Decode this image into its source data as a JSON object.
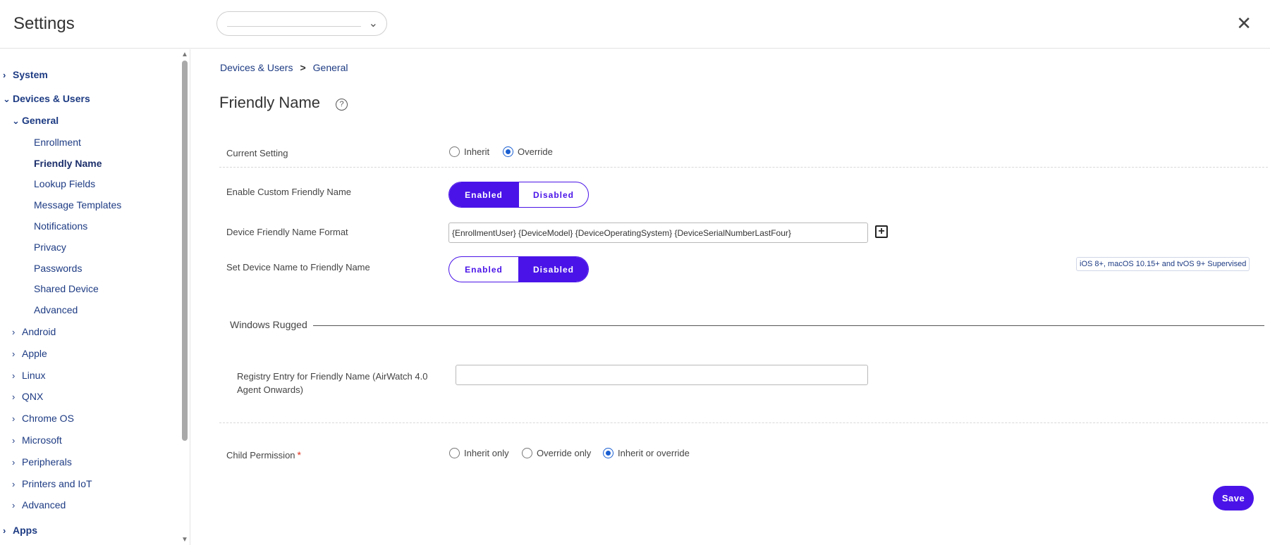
{
  "header": {
    "title": "Settings",
    "org_select_value": "",
    "close_icon": "close-icon"
  },
  "sidebar": {
    "items": [
      {
        "label": "System",
        "level": 1,
        "expanded": false
      },
      {
        "label": "Devices & Users",
        "level": 1,
        "expanded": true
      },
      {
        "label": "General",
        "level": 2,
        "expanded": true
      },
      {
        "label": "Enrollment",
        "level": 3
      },
      {
        "label": "Friendly Name",
        "level": 3,
        "active": true
      },
      {
        "label": "Lookup Fields",
        "level": 3
      },
      {
        "label": "Message Templates",
        "level": 3
      },
      {
        "label": "Notifications",
        "level": 3
      },
      {
        "label": "Privacy",
        "level": 3
      },
      {
        "label": "Passwords",
        "level": 3
      },
      {
        "label": "Shared Device",
        "level": 3
      },
      {
        "label": "Advanced",
        "level": 3
      },
      {
        "label": "Android",
        "level": 2,
        "expanded": false
      },
      {
        "label": "Apple",
        "level": 2,
        "expanded": false
      },
      {
        "label": "Linux",
        "level": 2,
        "expanded": false
      },
      {
        "label": "QNX",
        "level": 2,
        "expanded": false
      },
      {
        "label": "Chrome OS",
        "level": 2,
        "expanded": false
      },
      {
        "label": "Microsoft",
        "level": 2,
        "expanded": false
      },
      {
        "label": "Peripherals",
        "level": 2,
        "expanded": false
      },
      {
        "label": "Printers and IoT",
        "level": 2,
        "expanded": false
      },
      {
        "label": "Advanced",
        "level": 2,
        "expanded": false
      },
      {
        "label": "Apps",
        "level": 1,
        "expanded": false
      }
    ]
  },
  "breadcrumb": {
    "parent": "Devices & Users",
    "separator": ">",
    "current": "General"
  },
  "page": {
    "title": "Friendly Name",
    "help_icon": "?"
  },
  "current_setting": {
    "label": "Current Setting",
    "options": [
      "Inherit",
      "Override"
    ],
    "selected": "Override"
  },
  "enable_custom": {
    "label": "Enable Custom Friendly Name",
    "enabled_label": "Enabled",
    "disabled_label": "Disabled",
    "value": "Enabled"
  },
  "name_format": {
    "label": "Device Friendly Name Format",
    "value": "{EnrollmentUser} {DeviceModel} {DeviceOperatingSystem} {DeviceSerialNumberLastFour}",
    "add_symbol": "+"
  },
  "set_device_name": {
    "label": "Set Device Name to Friendly Name",
    "enabled_label": "Enabled",
    "disabled_label": "Disabled",
    "value": "Disabled",
    "support_badge": "iOS 8+, macOS 10.15+ and tvOS 9+ Supervised"
  },
  "windows_rugged": {
    "section_title": "Windows Rugged",
    "registry_label_line1": "Registry Entry for Friendly Name (AirWatch 4.0",
    "registry_label_line2": "Agent Onwards)",
    "registry_value": ""
  },
  "child_permission": {
    "label": "Child Permission",
    "required_mark": "*",
    "options": [
      "Inherit only",
      "Override only",
      "Inherit or override"
    ],
    "selected": "Inherit or override"
  },
  "footer": {
    "save_label": "Save"
  },
  "colors": {
    "accent": "#4a14e8",
    "nav_link": "#1d3b83",
    "radio_selected": "#1a5fd1",
    "required": "#e0301e"
  }
}
